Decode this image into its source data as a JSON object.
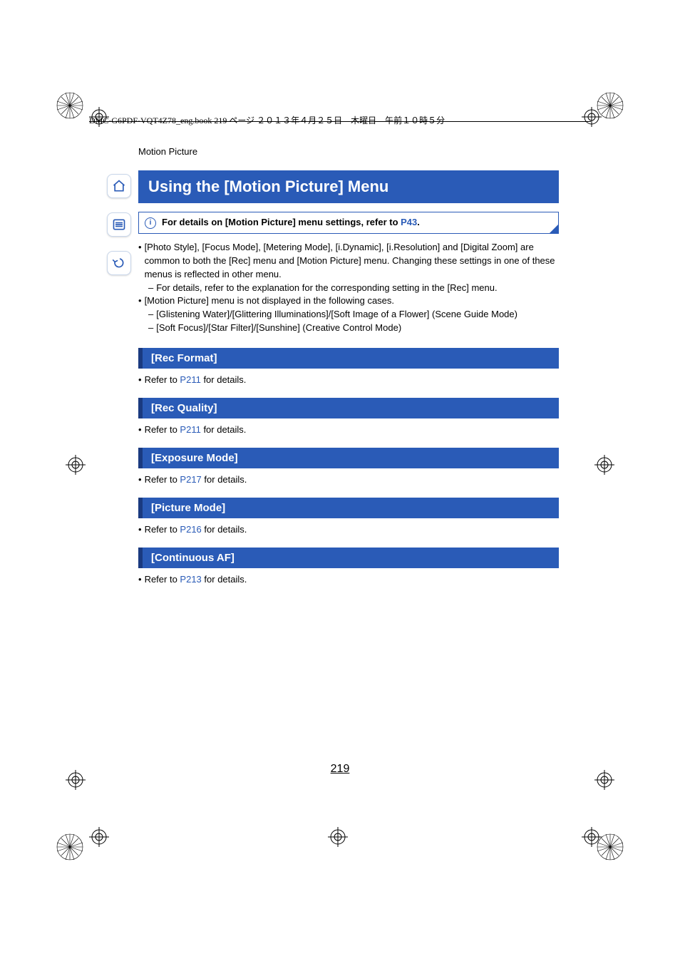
{
  "book_header": "DMC-G6PDF-VQT4Z78_eng.book  219 ページ  ２０１３年４月２５日　木曜日　午前１０時５分",
  "breadcrumb": "Motion Picture",
  "section_title": "Using the [Motion Picture] Menu",
  "callout": {
    "icon": "i",
    "text_prefix": "For details on [Motion Picture] menu settings, refer to ",
    "link": "P43",
    "text_suffix": "."
  },
  "intro": {
    "b1": "[Photo Style], [Focus Mode], [Metering Mode], [i.Dynamic], [i.Resolution] and [Digital Zoom] are common to both the [Rec] menu and [Motion Picture] menu. Changing these settings in one of these menus is reflected in other menu.",
    "d1": "For details, refer to the explanation for the corresponding setting in the [Rec] menu.",
    "b2": "[Motion Picture] menu is not displayed in the following cases.",
    "d2": "[Glistening Water]/[Glittering Illuminations]/[Soft Image of a Flower] (Scene Guide Mode)",
    "d3": "[Soft Focus]/[Star Filter]/[Sunshine] (Creative Control Mode)"
  },
  "sections": [
    {
      "title": "[Rec Format]",
      "ref_prefix": "Refer to ",
      "ref_link": "P211",
      "ref_suffix": " for details."
    },
    {
      "title": "[Rec Quality]",
      "ref_prefix": "Refer to ",
      "ref_link": "P211",
      "ref_suffix": " for details."
    },
    {
      "title": "[Exposure Mode]",
      "ref_prefix": "Refer to ",
      "ref_link": "P217",
      "ref_suffix": " for details."
    },
    {
      "title": "[Picture Mode]",
      "ref_prefix": "Refer to ",
      "ref_link": "P216",
      "ref_suffix": " for details."
    },
    {
      "title": "[Continuous AF]",
      "ref_prefix": "Refer to ",
      "ref_link": "P213",
      "ref_suffix": " for details."
    }
  ],
  "side_icons": {
    "home": "home-icon",
    "menu": "menu-icon",
    "back": "back-icon"
  },
  "page_number": "219"
}
